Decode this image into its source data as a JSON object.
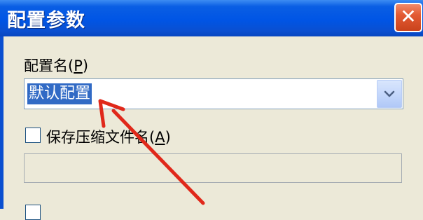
{
  "window": {
    "title": "配置参数",
    "close_glyph": "✕"
  },
  "config_name": {
    "label_prefix": "配置名(",
    "label_mnemonic": "P",
    "label_suffix": ")",
    "value": "默认配置",
    "dropdown_icon": "chevron-down-icon"
  },
  "save_compressed": {
    "label_prefix": "保存压缩文件名(",
    "label_mnemonic": "A",
    "label_suffix": ")",
    "checked": false,
    "input_value": ""
  },
  "annotation": {
    "arrow_color": "#e0281a"
  },
  "colors": {
    "titlebar": "#0055e5",
    "dialog_bg": "#ece9d8",
    "selection": "#316ac5",
    "close_button": "#e35a33"
  }
}
